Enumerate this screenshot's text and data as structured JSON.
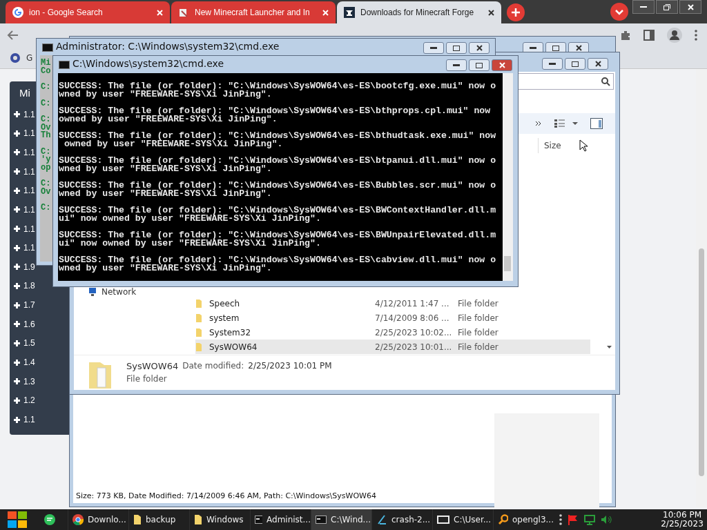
{
  "browser": {
    "tabs": [
      {
        "title": "ion - Google Search",
        "selected": false,
        "kind": "google"
      },
      {
        "title": "New Minecraft Launcher and In",
        "selected": false,
        "kind": "tool"
      },
      {
        "title": "Downloads for Minecraft Forge",
        "selected": true,
        "kind": "anvil"
      }
    ],
    "bookmark": "G"
  },
  "page": {
    "sidebar": {
      "heading": "Mi",
      "items": [
        "1.1",
        "1.1",
        "1.1",
        "1.1",
        "1.1",
        "1.1",
        "1.1",
        "1.1",
        "1.9",
        "1.8",
        "1.7",
        "1.6",
        "1.5",
        "1.4",
        "1.3",
        "1.2",
        "1.1"
      ]
    }
  },
  "back_window": {
    "status": "Size: 773 KB, Date Modified: 7/14/2009 6:46 AM, Path: C:\\Windows\\SysWOW64"
  },
  "explorer": {
    "column": "Size",
    "nav": "Network",
    "files": [
      {
        "name": "Speech",
        "date": "4/12/2011 1:47 ...",
        "type": "File folder",
        "selected": false
      },
      {
        "name": "system",
        "date": "7/14/2009 8:06 ...",
        "type": "File folder",
        "selected": false
      },
      {
        "name": "System32",
        "date": "2/25/2023 10:02...",
        "type": "File folder",
        "selected": false
      },
      {
        "name": "SysWOW64",
        "date": "2/25/2023 10:01...",
        "type": "File folder",
        "selected": true
      }
    ],
    "details": {
      "name": "SysWOW64",
      "date_label": "Date modified:",
      "date": "2/25/2023 10:01 PM",
      "type": "File folder"
    }
  },
  "admin_cmd": {
    "title": "Administrator: C:\\Windows\\system32\\cmd.exe",
    "groups": [
      [
        "Mi",
        "Co"
      ],
      [
        "C:"
      ],
      [
        "C:"
      ],
      [
        "C:",
        "Ov",
        "Th"
      ],
      [
        "C:",
        "'y",
        "op"
      ],
      [
        "C:",
        "Ov"
      ],
      [
        "C:"
      ]
    ]
  },
  "cmd": {
    "title": "C:\\Windows\\system32\\cmd.exe",
    "entries": [
      [
        "SUCCESS: The file (or folder): \"C:\\Windows\\SysWOW64\\es-ES\\bootcfg.exe.mui\" now o",
        "wned by user \"FREEWARE-SYS\\Xi JinPing\"."
      ],
      [
        "SUCCESS: The file (or folder): \"C:\\Windows\\SysWOW64\\es-ES\\bthprops.cpl.mui\" now",
        "owned by user \"FREEWARE-SYS\\Xi JinPing\"."
      ],
      [
        "SUCCESS: The file (or folder): \"C:\\Windows\\SysWOW64\\es-ES\\bthudtask.exe.mui\" now",
        " owned by user \"FREEWARE-SYS\\Xi JinPing\"."
      ],
      [
        "SUCCESS: The file (or folder): \"C:\\Windows\\SysWOW64\\es-ES\\btpanui.dll.mui\" now o",
        "wned by user \"FREEWARE-SYS\\Xi JinPing\"."
      ],
      [
        "SUCCESS: The file (or folder): \"C:\\Windows\\SysWOW64\\es-ES\\Bubbles.scr.mui\" now o",
        "wned by user \"FREEWARE-SYS\\Xi JinPing\"."
      ],
      [
        "SUCCESS: The file (or folder): \"C:\\Windows\\SysWOW64\\es-ES\\BWContextHandler.dll.m",
        "ui\" now owned by user \"FREEWARE-SYS\\Xi JinPing\"."
      ],
      [
        "SUCCESS: The file (or folder): \"C:\\Windows\\SysWOW64\\es-ES\\BWUnpairElevated.dll.m",
        "ui\" now owned by user \"FREEWARE-SYS\\Xi JinPing\"."
      ],
      [
        "SUCCESS: The file (or folder): \"C:\\Windows\\SysWOW64\\es-ES\\cabview.dll.mui\" now o",
        "wned by user \"FREEWARE-SYS\\Xi JinPing\"."
      ]
    ]
  },
  "taskbar": {
    "items": [
      {
        "label": "Downlo...",
        "kind": "chrome",
        "selected": false
      },
      {
        "label": "backup",
        "kind": "folder",
        "selected": false
      },
      {
        "label": "Windows",
        "kind": "folder",
        "selected": false
      },
      {
        "label": "Administ...",
        "kind": "cmd",
        "selected": false
      },
      {
        "label": "C:\\Wind...",
        "kind": "cmd",
        "selected": true
      },
      {
        "label": "crash-2...",
        "kind": "editor",
        "selected": false
      },
      {
        "label": "C:\\User...",
        "kind": "zip",
        "selected": false
      },
      {
        "label": "opengl3...",
        "kind": "search",
        "selected": false
      }
    ],
    "time": "10:06 PM",
    "date": "2/25/2023"
  }
}
